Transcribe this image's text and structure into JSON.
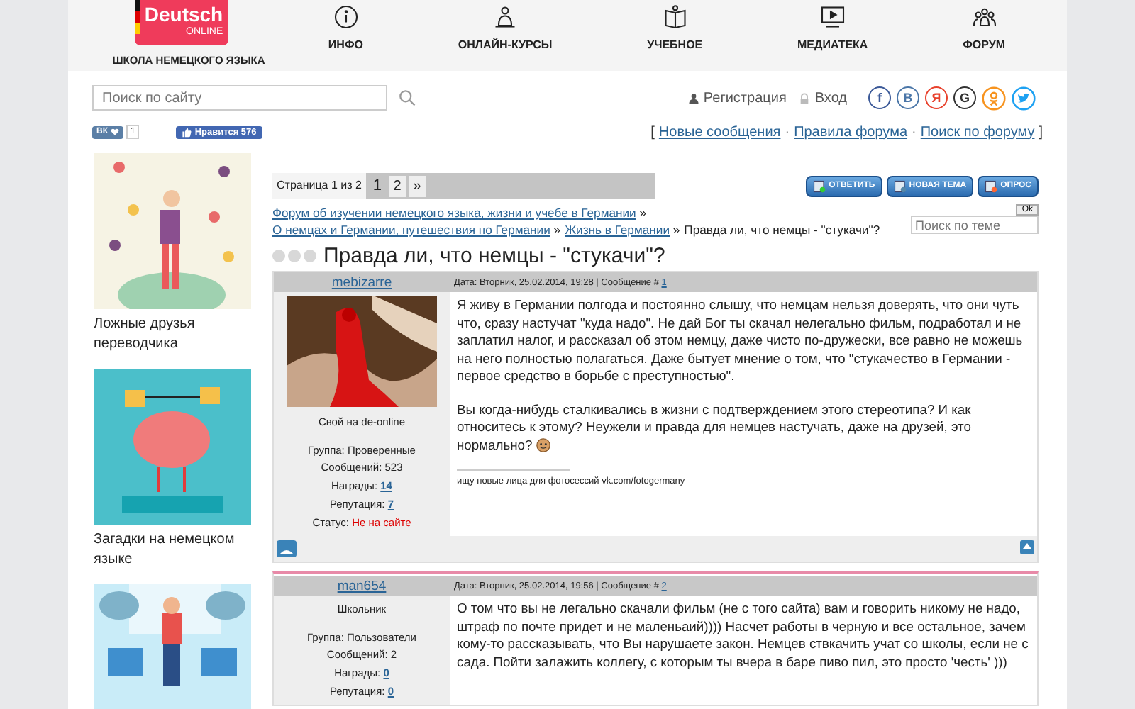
{
  "logo": {
    "title": "Deutsch",
    "subtitle": "ONLINE",
    "tagline": "ШКОЛА НЕМЕЦКОГО ЯЗЫКА"
  },
  "nav": [
    {
      "label": "ИНФО",
      "kind": "info"
    },
    {
      "label": "ОНЛАЙН-КУРСЫ",
      "kind": "courses"
    },
    {
      "label": "УЧЕБНОЕ",
      "kind": "book"
    },
    {
      "label": "МЕДИАТЕКА",
      "kind": "media"
    },
    {
      "label": "ФОРУМ",
      "kind": "forum"
    }
  ],
  "search": {
    "placeholder": "Поиск по сайту"
  },
  "auth": {
    "register": "Регистрация",
    "login": "Вход"
  },
  "socials": [
    {
      "kind": "letter",
      "text": "f",
      "color": "#3b5998"
    },
    {
      "kind": "letter",
      "text": "В",
      "color": "#4a76a8"
    },
    {
      "kind": "letter",
      "text": "Я",
      "color": "#e8412c"
    },
    {
      "kind": "letter",
      "text": "G",
      "color": "#333333"
    },
    {
      "kind": "ok",
      "color": "#f7931e"
    },
    {
      "kind": "twitter",
      "color": "#1da1f2"
    }
  ],
  "widgets": {
    "vk": "ВК",
    "vk_count": "1",
    "fb_like": "Нравится 576"
  },
  "forum_links": [
    "Новые сообщения",
    "Правила форума",
    "Поиск по форуму"
  ],
  "forum_links_open": "[",
  "forum_links_sep": "·",
  "forum_links_close": "]",
  "crumb_sep": "»",
  "sidebar": [
    {
      "kind": "picture",
      "caption": "Ложные друзья переводчика"
    },
    {
      "kind": "picture",
      "caption": "Загадки на немецком языке"
    },
    {
      "kind": "picture"
    }
  ],
  "pager": {
    "label": "Страница 1 из 2",
    "pages": [
      {
        "text": "1",
        "selected": true
      },
      {
        "text": "2",
        "selected": false
      },
      {
        "text": "»",
        "selected": false
      }
    ]
  },
  "actions": [
    "ОТВЕТИТЬ",
    "НОВАЯ ТЕМА",
    "ОПРОС"
  ],
  "breadcrumbs": [
    "Форум об изучении немецкого языка, жизни и учебе в Германии",
    "О немцах и Германии, путешествия по Германии",
    "Жизнь в Германии"
  ],
  "current": "Правда ли, что немцы - \"стукачи\"?",
  "topic_search": {
    "button": "Ok",
    "placeholder": "Поиск по теме"
  },
  "title": "Правда ли, что немцы - \"стукачи\"?",
  "posts": [
    {
      "user": "mebizarre",
      "date": "Дата: Вторник, 25.02.2014, 19:28 | Сообщение #",
      "num": "1",
      "avatar": true,
      "rank": "Свой на de-online",
      "group": "Группа: Проверенные",
      "count": "Сообщений: 523",
      "awards_label": "Награды:",
      "awards": "14",
      "rep_label": "Репутация:",
      "rep": "7",
      "status_label": "Статус:",
      "status": "Не на сайте",
      "online": false,
      "paragraphs": [
        "Я живу в Германии полгода и постоянно слышу, что немцам нельзя доверять, что они чуть что, сразу настучат \"куда надо\". Не дай Бог ты скачал нелегально фильм, подработал и не заплатил налог, и рассказал об этом немцу, даже чисто по-дружески, все равно не можешь на него полностью полагаться. Даже бытует мнение о том, что \"стукачество в Германии - первое средство в борьбе с преступностью\".",
        "Вы когда-нибудь сталкивались в жизни с подтверждением этого стереотипа? И как относитесь к этому? Неужели и правда для немцев настучать, даже на друзей, это нормально?"
      ],
      "smile": true,
      "signature": "ищу новые лица для фотосессий vk.com/fotogermany"
    },
    {
      "user": "man654",
      "date": "Дата: Вторник, 25.02.2014, 19:56 | Сообщение #",
      "num": "2",
      "avatar": false,
      "rank": "Школьник",
      "group": "Группа: Пользователи",
      "count": "Сообщений: 2",
      "awards_label": "Награды:",
      "awards": "0",
      "rep_label": "Репутация:",
      "rep": "0",
      "paragraphs": [
        "О том что вы не легально скачали фильм (не с того сайта) вам и говорить никому не надо, штраф по почте придет и не маленьаий)))) Насчет работы в черную и все остальное, зачем кому-то рассказывать, что Вы нарушаете закон. Немцев ствкачить учат со школы, если не с сада. Пойти залажить коллегу, с которым ты вчера в баре пиво пил, это просто 'честь' )))"
      ],
      "smile": false
    }
  ]
}
